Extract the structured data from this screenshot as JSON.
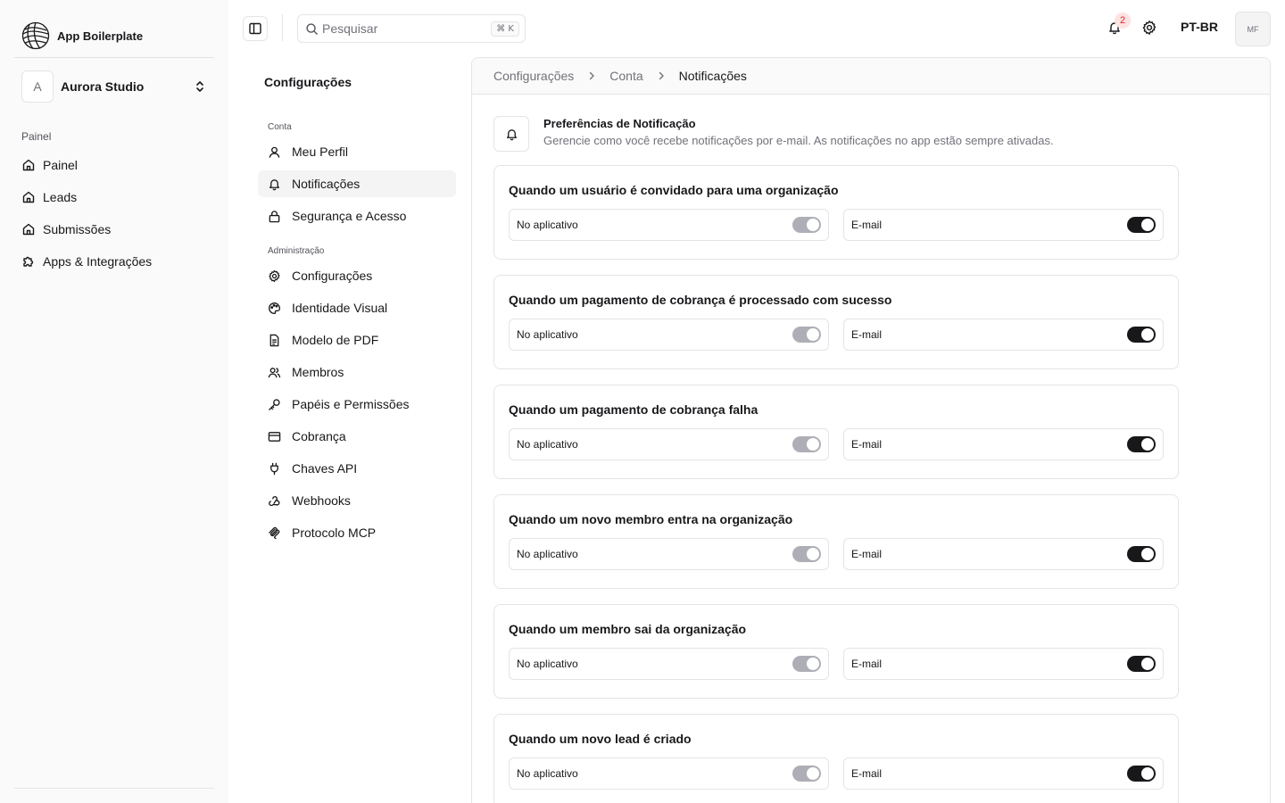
{
  "app": {
    "name": "App Boilerplate"
  },
  "org": {
    "initial": "A",
    "name": "Aurora Studio"
  },
  "sidebar": {
    "group_label": "Painel",
    "items": [
      {
        "label": "Painel",
        "icon": "home-icon"
      },
      {
        "label": "Leads",
        "icon": "home-icon"
      },
      {
        "label": "Submissões",
        "icon": "home-icon"
      },
      {
        "label": "Apps & Integrações",
        "icon": "puzzle-icon"
      }
    ]
  },
  "topbar": {
    "search_placeholder": "Pesquisar",
    "search_shortcut": "⌘ K",
    "notification_count": "2",
    "language": "PT-BR",
    "user_initials": "MF"
  },
  "settings_nav": {
    "title": "Configurações",
    "groups": [
      {
        "label": "Conta",
        "items": [
          {
            "label": "Meu Perfil",
            "icon": "user-icon",
            "active": false
          },
          {
            "label": "Notificações",
            "icon": "bell-icon",
            "active": true
          },
          {
            "label": "Segurança e Acesso",
            "icon": "lock-icon",
            "active": false
          }
        ]
      },
      {
        "label": "Administração",
        "items": [
          {
            "label": "Configurações",
            "icon": "gear-icon",
            "active": false
          },
          {
            "label": "Identidade Visual",
            "icon": "palette-icon",
            "active": false
          },
          {
            "label": "Modelo de PDF",
            "icon": "document-icon",
            "active": false
          },
          {
            "label": "Membros",
            "icon": "users-icon",
            "active": false
          },
          {
            "label": "Papéis e Permissões",
            "icon": "key-icon",
            "active": false
          },
          {
            "label": "Cobrança",
            "icon": "credit-card-icon",
            "active": false
          },
          {
            "label": "Chaves API",
            "icon": "plug-icon",
            "active": false
          },
          {
            "label": "Webhooks",
            "icon": "webhook-icon",
            "active": false
          },
          {
            "label": "Protocolo MCP",
            "icon": "mcp-icon",
            "active": false
          }
        ]
      }
    ]
  },
  "breadcrumb": [
    "Configurações",
    "Conta",
    "Notificações"
  ],
  "preferences": {
    "title": "Preferências de Notificação",
    "description": "Gerencie como você recebe notificações por e-mail. As notificações no app estão sempre ativadas."
  },
  "notifications": [
    {
      "title": "Quando um usuário é convidado para uma organização",
      "in_app_label": "No aplicativo",
      "in_app_on": true,
      "in_app_disabled": true,
      "email_label": "E-mail",
      "email_on": true
    },
    {
      "title": "Quando um pagamento de cobrança é processado com sucesso",
      "in_app_label": "No aplicativo",
      "in_app_on": true,
      "in_app_disabled": true,
      "email_label": "E-mail",
      "email_on": true
    },
    {
      "title": "Quando um pagamento de cobrança falha",
      "in_app_label": "No aplicativo",
      "in_app_on": true,
      "in_app_disabled": true,
      "email_label": "E-mail",
      "email_on": true
    },
    {
      "title": "Quando um novo membro entra na organização",
      "in_app_label": "No aplicativo",
      "in_app_on": true,
      "in_app_disabled": true,
      "email_label": "E-mail",
      "email_on": true
    },
    {
      "title": "Quando um membro sai da organização",
      "in_app_label": "No aplicativo",
      "in_app_on": true,
      "in_app_disabled": true,
      "email_label": "E-mail",
      "email_on": true
    },
    {
      "title": "Quando um novo lead é criado",
      "in_app_label": "No aplicativo",
      "in_app_on": true,
      "in_app_disabled": true,
      "email_label": "E-mail",
      "email_on": true
    }
  ],
  "colors": {
    "text": "#18181b",
    "muted": "#71717a",
    "border": "#e4e4e7",
    "sidebar_bg": "#fafafa",
    "switch_on": "#18181b",
    "switch_disabled": "#a1a1aa",
    "badge": "#dc2626"
  }
}
